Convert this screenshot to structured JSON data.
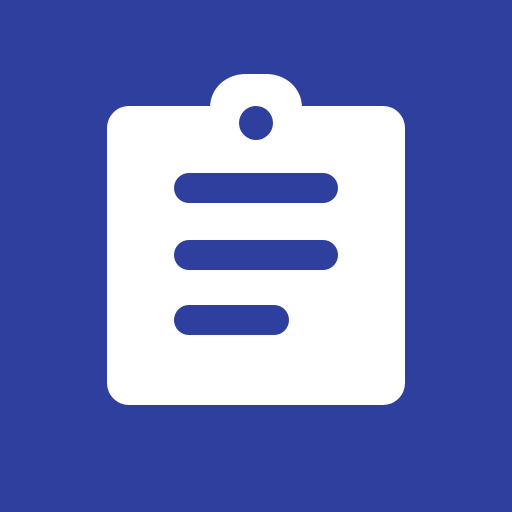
{
  "app_icon": {
    "icon": "clipboard-list-icon",
    "background_color": "#2e3f9e",
    "foreground_color": "#ffffff"
  }
}
